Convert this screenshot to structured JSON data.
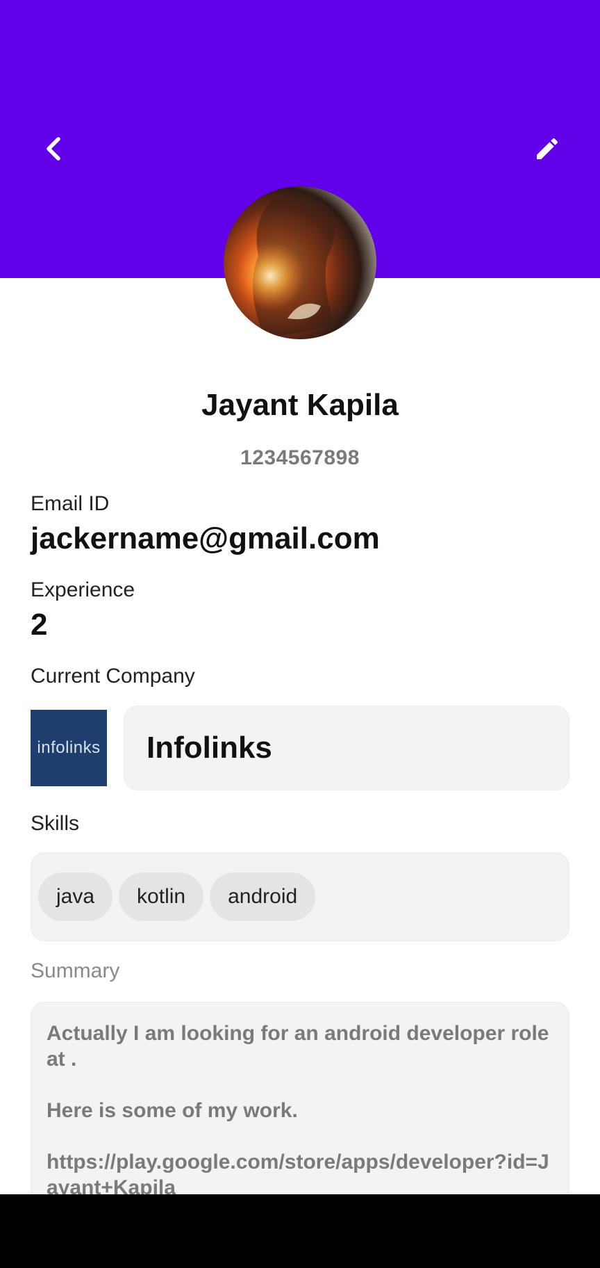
{
  "header": {
    "background_color": "#6200ea",
    "back_icon": "chevron-left-icon",
    "edit_icon": "pencil-icon"
  },
  "profile": {
    "name": "Jayant Kapila",
    "phone": "1234567898"
  },
  "email": {
    "label": "Email ID",
    "value": "jackername@gmail.com"
  },
  "experience": {
    "label": "Experience",
    "value": "2"
  },
  "company": {
    "label": "Current Company",
    "logo_text": "infolinks",
    "name": "Infolinks"
  },
  "skills": {
    "label": "Skills",
    "items": [
      "java",
      "kotlin",
      "android"
    ]
  },
  "summary": {
    "label": "Summary",
    "text": "Actually I am looking for an android developer role at .\n\nHere is some of my work.\n\nhttps://play.google.com/store/apps/developer?id=Jayant+Kapila"
  }
}
